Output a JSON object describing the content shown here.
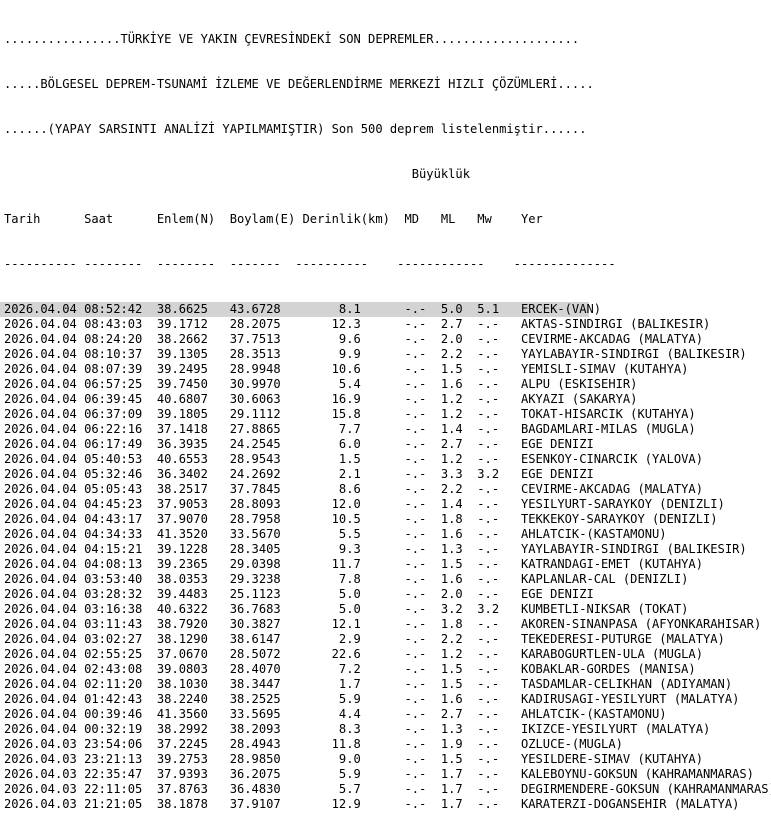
{
  "banner": [
    "................TÜRKİYE VE YAKIN ÇEVRESİNDEKİ SON DEPREMLER....................",
    ".....BÖLGESEL DEPREM-TSUNAMİ İZLEME VE DEĞERLENDİRME MERKEZİ HIZLI ÇÖZÜMLERİ.....",
    "......(YAPAY SARSINTI ANALİZİ YAPILMAMIŞTIR) Son 500 deprem listelenmiştir......"
  ],
  "header": {
    "group_line": "                                                        Büyüklük",
    "columns_line": "Tarih      Saat      Enlem(N)  Boylam(E) Derinlik(km)  MD   ML   Mw    Yer",
    "divider_line": "---------- --------  --------  -------  ----------    ------------    --------------"
  },
  "selected_index": 0,
  "rows": [
    "2026.04.04 08:52:42  38.6625   43.6728        8.1      -.-  5.0  5.1   ERCEK-(VAN)",
    "2026.04.04 08:43:03  39.1712   28.2075       12.3      -.-  2.7  -.-   AKTAS-SINDIRGI (BALIKESIR)",
    "2026.04.04 08:24:20  38.2662   37.7513        9.6      -.-  2.0  -.-   CEVIRME-AKCADAG (MALATYA)",
    "2026.04.04 08:10:37  39.1305   28.3513        9.9      -.-  2.2  -.-   YAYLABAYIR-SINDIRGI (BALIKESIR)",
    "2026.04.04 08:07:39  39.2495   28.9948       10.6      -.-  1.5  -.-   YEMISLI-SIMAV (KUTAHYA)",
    "2026.04.04 06:57:25  39.7450   30.9970        5.4      -.-  1.6  -.-   ALPU (ESKISEHIR)",
    "2026.04.04 06:39:45  40.6807   30.6063       16.9      -.-  1.2  -.-   AKYAZI (SAKARYA)",
    "2026.04.04 06:37:09  39.1805   29.1112       15.8      -.-  1.2  -.-   TOKAT-HISARCIK (KUTAHYA)",
    "2026.04.04 06:22:16  37.1418   27.8865        7.7      -.-  1.4  -.-   BAGDAMLARI-MILAS (MUGLA)",
    "2026.04.04 06:17:49  36.3935   24.2545        6.0      -.-  2.7  -.-   EGE DENIZI",
    "2026.04.04 05:40:53  40.6553   28.9543        1.5      -.-  1.2  -.-   ESENKOY-CINARCIK (YALOVA)",
    "2026.04.04 05:32:46  36.3402   24.2692        2.1      -.-  3.3  3.2   EGE DENIZI",
    "2026.04.04 05:05:43  38.2517   37.7845        8.6      -.-  2.2  -.-   CEVIRME-AKCADAG (MALATYA)",
    "2026.04.04 04:45:23  37.9053   28.8093       12.0      -.-  1.4  -.-   YESILYURT-SARAYKOY (DENIZLI)",
    "2026.04.04 04:43:17  37.9070   28.7958       10.5      -.-  1.8  -.-   TEKKEKOY-SARAYKOY (DENIZLI)",
    "2026.04.04 04:34:33  41.3520   33.5670        5.5      -.-  1.6  -.-   AHLATCIK-(KASTAMONU)",
    "2026.04.04 04:15:21  39.1228   28.3405        9.3      -.-  1.3  -.-   YAYLABAYIR-SINDIRGI (BALIKESIR)",
    "2026.04.04 04:08:13  39.2365   29.0398       11.7      -.-  1.5  -.-   KATRANDAGI-EMET (KUTAHYA)",
    "2026.04.04 03:53:40  38.0353   29.3238        7.8      -.-  1.6  -.-   KAPLANLAR-CAL (DENIZLI)",
    "2026.04.04 03:28:32  39.4483   25.1123        5.0      -.-  2.0  -.-   EGE DENIZI",
    "2026.04.04 03:16:38  40.6322   36.7683        5.0      -.-  3.2  3.2   KUMBETLI-NIKSAR (TOKAT)",
    "2026.04.04 03:11:43  38.7920   30.3827       12.1      -.-  1.8  -.-   AKOREN-SINANPASA (AFYONKARAHISAR)",
    "2026.04.04 03:02:27  38.1290   38.6147        2.9      -.-  2.2  -.-   TEKEDERESI-PUTURGE (MALATYA)",
    "2026.04.04 02:55:25  37.0670   28.5072       22.6      -.-  1.2  -.-   KARABOGURTLEN-ULA (MUGLA)",
    "2026.04.04 02:43:08  39.0803   28.4070        7.2      -.-  1.5  -.-   KOBAKLAR-GORDES (MANISA)",
    "2026.04.04 02:11:20  38.1030   38.3447        1.7      -.-  1.5  -.-   TASDAMLAR-CELIKHAN (ADIYAMAN)",
    "2026.04.04 01:42:43  38.2240   38.2525        5.9      -.-  1.6  -.-   KADIRUSAGI-YESILYURT (MALATYA)",
    "2026.04.04 00:39:46  41.3560   33.5695        4.4      -.-  2.7  -.-   AHLATCIK-(KASTAMONU)",
    "2026.04.04 00:32:19  38.2992   38.2093        8.3      -.-  1.3  -.-   IKIZCE-YESILYURT (MALATYA)",
    "2026.04.03 23:54:06  37.2245   28.4943       11.8      -.-  1.9  -.-   OZLUCE-(MUGLA)",
    "2026.04.03 23:21:13  39.2753   28.9850        9.0      -.-  1.5  -.-   YESILDERE-SIMAV (KUTAHYA)",
    "2026.04.03 22:35:47  37.9393   36.2075        5.9      -.-  1.7  -.-   KALEBOYNU-GOKSUN (KAHRAMANMARAS)",
    "2026.04.03 22:11:05  37.8763   36.4830        5.7      -.-  1.7  -.-   DEGIRMENDERE-GOKSUN (KAHRAMANMARAS)",
    "2026.04.03 21:21:05  38.1878   37.9107       12.9      -.-  1.7  -.-   KARATERZI-DOGANSEHIR (MALATYA)"
  ]
}
